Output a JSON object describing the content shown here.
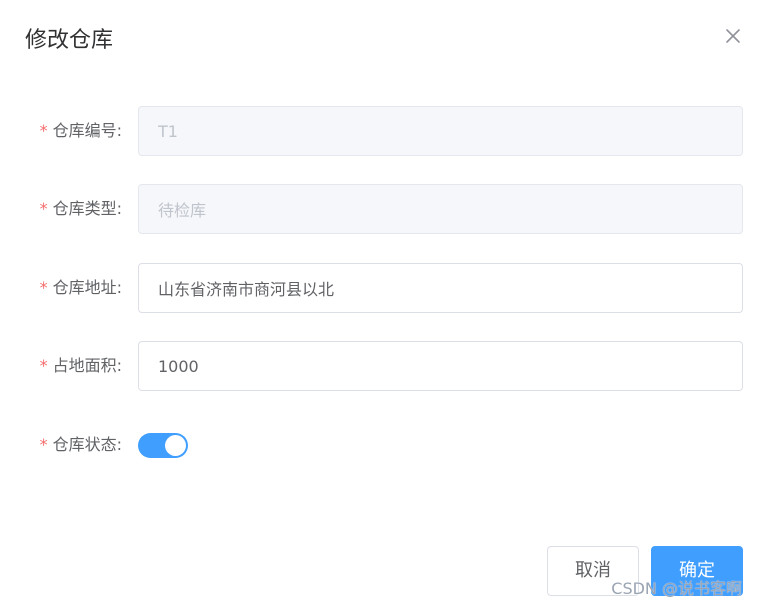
{
  "dialog": {
    "title": "修改仓库",
    "close_icon": "close-icon"
  },
  "form": {
    "required_mark": "*",
    "fields": [
      {
        "label": "仓库编号:",
        "value": "T1",
        "disabled": true
      },
      {
        "label": "仓库类型:",
        "value": "待检库",
        "disabled": true
      },
      {
        "label": "仓库地址:",
        "value": "山东省济南市商河县以北",
        "disabled": false
      },
      {
        "label": "占地面积:",
        "value": "1000",
        "disabled": false
      }
    ],
    "status": {
      "label": "仓库状态:",
      "on": true
    }
  },
  "footer": {
    "cancel_label": "取消",
    "confirm_label": "确定"
  },
  "watermark": "CSDN @说书客啊",
  "colors": {
    "primary": "#409eff",
    "required": "#f56c6c",
    "text": "#606266",
    "title": "#303133",
    "disabled_bg": "#f5f7fa",
    "disabled_text": "#c0c4cc",
    "border": "#dcdfe6"
  }
}
